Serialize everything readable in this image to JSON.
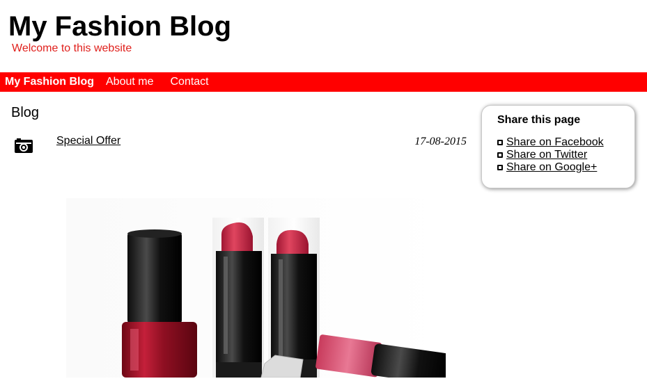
{
  "header": {
    "title": "My Fashion Blog",
    "tagline": "Welcome to this website"
  },
  "nav": {
    "items": [
      {
        "label": "My Fashion Blog"
      },
      {
        "label": "About me"
      },
      {
        "label": "Contact"
      }
    ]
  },
  "main": {
    "heading": "Blog",
    "posts": [
      {
        "icon": "camera-icon",
        "title": "Special Offer",
        "date": "17-08-2015"
      }
    ],
    "image": {
      "subject": "lipsticks-and-nail-polish-photo"
    }
  },
  "share": {
    "title": "Share this page",
    "links": [
      {
        "label": "Share on Facebook",
        "icon": "facebook-icon"
      },
      {
        "label": "Share on Twitter",
        "icon": "twitter-icon"
      },
      {
        "label": "Share on Google+",
        "icon": "google-plus-icon"
      }
    ]
  },
  "colors": {
    "nav_background": "#ff0000",
    "tagline": "#e0201c",
    "text": "#000000",
    "background": "#ffffff"
  }
}
